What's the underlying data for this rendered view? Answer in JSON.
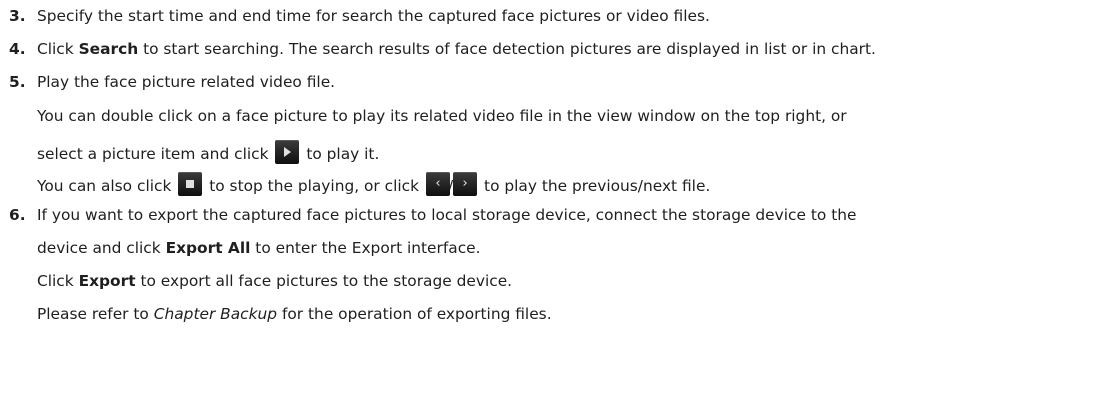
{
  "steps": [
    {
      "num": "3.",
      "text": "Specify the start time and end time for search the captured face pictures or video files."
    },
    {
      "num": "4.",
      "pre": "Click ",
      "bold": "Search",
      "post": " to start searching. The search results of face detection pictures are displayed in list or in chart."
    },
    {
      "num": "5.",
      "text": "Play the face picture related video file.",
      "para1_line1": "You can double click on a face picture to play its related video file in the view window on the top right, or",
      "para1_line2_pre": "select a picture item and click",
      "para1_line2_post": "to play it.",
      "para2_pre": "You can also click",
      "para2_mid": "to stop the playing, or click",
      "para2_slash": "/",
      "para2_post": "to play the previous/next file."
    },
    {
      "num": "6.",
      "line1": "If you want to export the captured face pictures to local storage device, connect the storage device to the",
      "line2_pre": "device and click ",
      "line2_bold": "Export All",
      "line2_post": " to enter the Export interface.",
      "line3_pre": "Click ",
      "line3_bold": "Export",
      "line3_post": " to export all face pictures to the storage device.",
      "line4_pre": "Please refer to ",
      "line4_italic": "Chapter Backup",
      "line4_post": " for the operation of exporting files."
    }
  ],
  "icons": {
    "play": "play-icon",
    "stop": "stop-icon",
    "previous": "previous-icon",
    "next": "next-icon"
  }
}
